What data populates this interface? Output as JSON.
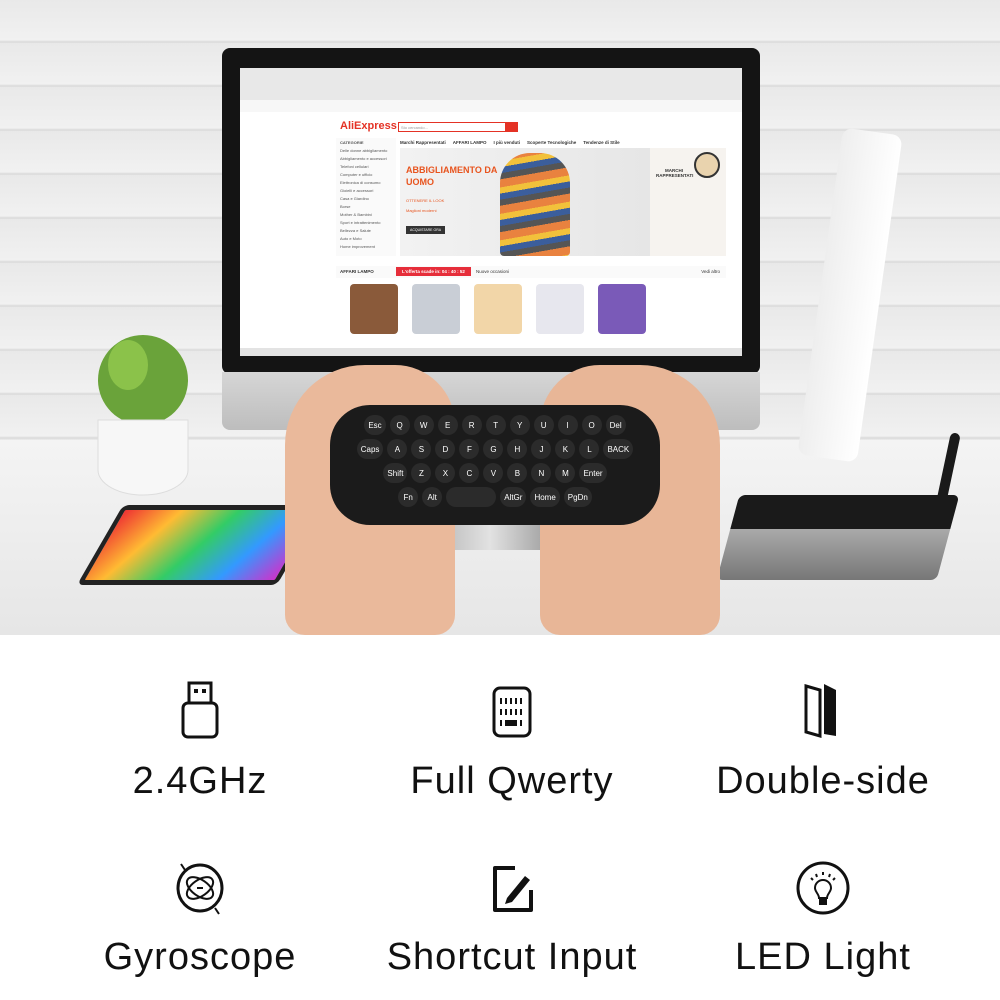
{
  "screen": {
    "logo": "AliExpress",
    "search_placeholder": "Sto cercando...",
    "nav": [
      "Marchi Rappresentati",
      "AFFARI LAMPO",
      "I più venduti",
      "Scoperte Tecnologiche",
      "Tendenze di Stile"
    ],
    "categories_title": "CATEGORIE",
    "categories": [
      "Delle donne abbigliamento",
      "Abbigliamento e accessori",
      "Telefoni cellulari",
      "Computer e ufficio",
      "Elettronica di consumo",
      "Gioielli e accessori",
      "Casa e Giardino",
      "Borse",
      "Mother & Bambini",
      "Sport e intrattenimento",
      "Bellezza e Salute",
      "Auto e Moto",
      "Home improvement"
    ],
    "banner_title": "ABBIGLIAMENTO DA UOMO",
    "banner_links": [
      "OTTENERE IL LOOK",
      "Maglioni moderni"
    ],
    "banner_cta": "ACQUISTARE ORA",
    "side_title": "MARCHI RAPPRESENTATI",
    "flash_title": "AFFARI LAMPO",
    "countdown": "L'offerta scade in: 04 : 40 : 52",
    "flash_sub": "Nuove occasioni",
    "flash_more": "Vedi altro"
  },
  "keyboard": {
    "rows": [
      [
        "Esc",
        "Q",
        "W",
        "E",
        "R",
        "T",
        "Y",
        "U",
        "I",
        "O",
        "Del"
      ],
      [
        "Caps",
        "A",
        "S",
        "D",
        "F",
        "G",
        "H",
        "J",
        "K",
        "L",
        "BACK"
      ],
      [
        "Shift",
        "Z",
        "X",
        "C",
        "V",
        "B",
        "N",
        "M",
        "Enter"
      ],
      [
        "Fn",
        "Alt",
        "",
        "AltGr",
        "Home",
        "PgDn"
      ]
    ]
  },
  "features": [
    {
      "label": "2.4GHz",
      "icon": "usb-dongle-icon"
    },
    {
      "label": "Full Qwerty",
      "icon": "keyboard-icon"
    },
    {
      "label": "Double-side",
      "icon": "double-side-icon"
    },
    {
      "label": "Gyroscope",
      "icon": "gyroscope-icon"
    },
    {
      "label": "Shortcut Input",
      "icon": "edit-icon"
    },
    {
      "label": "LED Light",
      "icon": "bulb-icon"
    }
  ],
  "colors": {
    "brand": "#e43225",
    "text": "#111111"
  }
}
